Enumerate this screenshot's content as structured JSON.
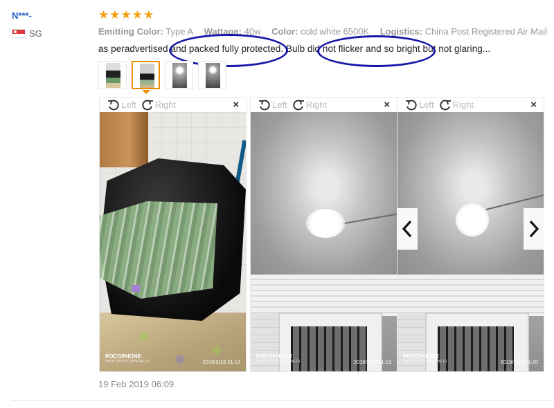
{
  "reviewer": {
    "name": "N***-",
    "country": "SG",
    "flag_icon": "singapore-flag-icon"
  },
  "rating": {
    "stars": 5,
    "max": 5,
    "star_color": "#f59e0b"
  },
  "attributes": [
    {
      "key": "Emitting Color:",
      "value": "Type A"
    },
    {
      "key": "Wattage:",
      "value": "40w"
    },
    {
      "key": "Color:",
      "value": "cold white 6500K"
    },
    {
      "key": "Logistics:",
      "value": "China Post Registered Air Mail"
    }
  ],
  "review_text": "as peradvertised and packed fully protected. Bulb did not flicker and so bright but not glaring...",
  "annotation_color": "#1518a8",
  "thumbnails": [
    {
      "icon": "photo-thumbnail-package"
    },
    {
      "icon": "photo-thumbnail-package-box"
    },
    {
      "icon": "photo-thumbnail-ceiling-light"
    },
    {
      "icon": "photo-thumbnail-ceiling-light-2"
    }
  ],
  "active_thumbnail_index": 1,
  "viewer": {
    "rotate_left_label": "Left",
    "rotate_right_label": "Right",
    "close_label": "×"
  },
  "photos": [
    {
      "watermark": "POCOPHONE",
      "watermark_sub": "SHOT ON POCOPHONE F1",
      "timestamp": "2019/2/19  21:12"
    },
    {
      "watermark": "POCOPHONE",
      "watermark_sub": "SHOT ON POCOPHONE F1",
      "timestamp": "2019/2/19  21:19"
    },
    {
      "watermark": "POCOPHONE",
      "watermark_sub": "SHOT ON POCOPHONE F1",
      "timestamp": "2019/2/19  21:20"
    }
  ],
  "carousel": {
    "prev_icon": "chevron-left-icon",
    "next_icon": "chevron-right-icon"
  },
  "review_date": "19 Feb 2019 06:09"
}
